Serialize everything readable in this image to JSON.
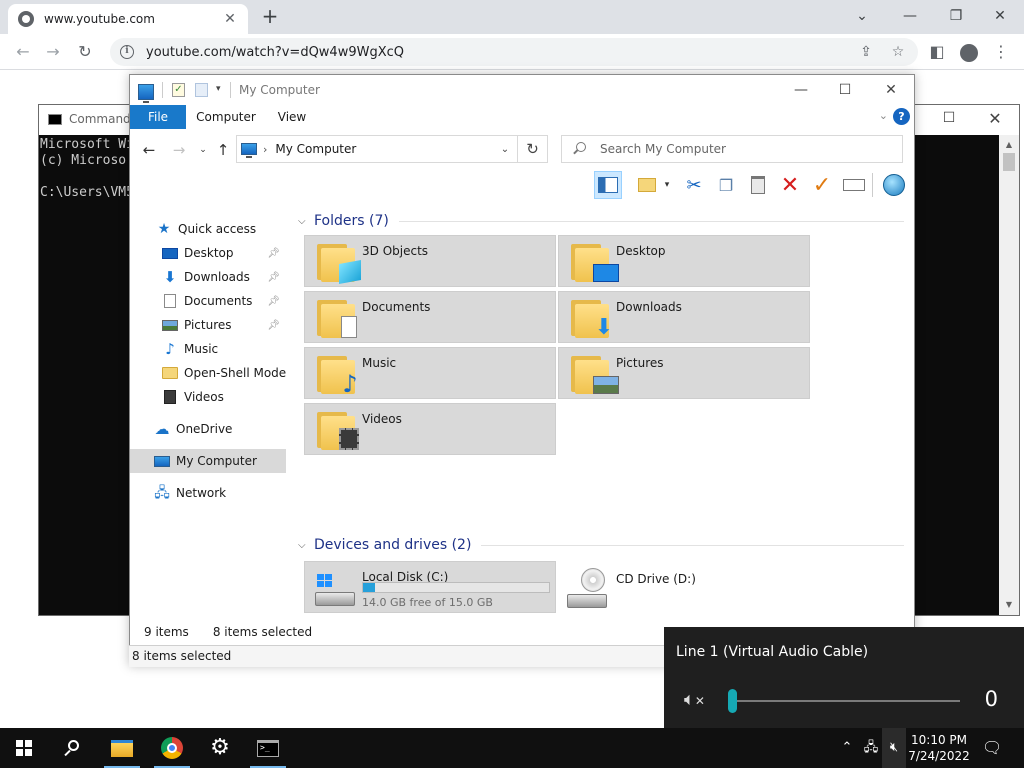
{
  "browser": {
    "tab_title": "www.youtube.com",
    "url": "youtube.com/watch?v=dQw4w9WgXcQ"
  },
  "cmd": {
    "title": "Command",
    "lines": [
      "Microsoft Wi",
      "(c) Microso",
      "",
      "C:\\Users\\VM5"
    ]
  },
  "explorer": {
    "title": "My Computer",
    "ribbon_tabs": {
      "file": "File",
      "computer": "Computer",
      "view": "View"
    },
    "address_crumb": "My Computer",
    "search_placeholder": "Search My Computer",
    "nav": {
      "quick_access": "Quick access",
      "desktop": "Desktop",
      "downloads": "Downloads",
      "documents": "Documents",
      "pictures": "Pictures",
      "music": "Music",
      "open_shell": "Open-Shell Modern",
      "videos": "Videos",
      "onedrive": "OneDrive",
      "my_computer": "My Computer",
      "network": "Network"
    },
    "folders_group": "Folders (7)",
    "folders": {
      "objects3d": "3D Objects",
      "desktop": "Desktop",
      "documents": "Documents",
      "downloads": "Downloads",
      "music": "Music",
      "pictures": "Pictures",
      "videos": "Videos"
    },
    "devices_group": "Devices and drives (2)",
    "drives": {
      "local_name": "Local Disk (C:)",
      "local_free": "14.0 GB free of 15.0 GB",
      "local_used_fraction": 0.067,
      "cd_name": "CD Drive (D:)"
    },
    "status": {
      "items": "9 items",
      "selected": "8 items selected",
      "bottom": "8 items selected"
    }
  },
  "volume": {
    "device": "Line 1 (Virtual Audio Cable)",
    "level": "0"
  },
  "taskbar": {
    "time": "10:10 PM",
    "date": "7/24/2022"
  },
  "colors": {
    "accent": "#1979ca",
    "volume_thumb": "#16a9b4",
    "drive_bar": "#26a0da"
  }
}
